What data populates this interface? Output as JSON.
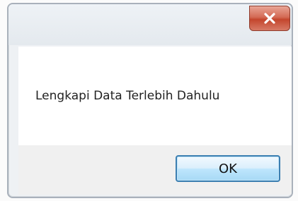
{
  "dialog": {
    "close_icon": "close-icon",
    "message": "Lengkapi Data Terlebih Dahulu",
    "ok_label": "OK"
  }
}
